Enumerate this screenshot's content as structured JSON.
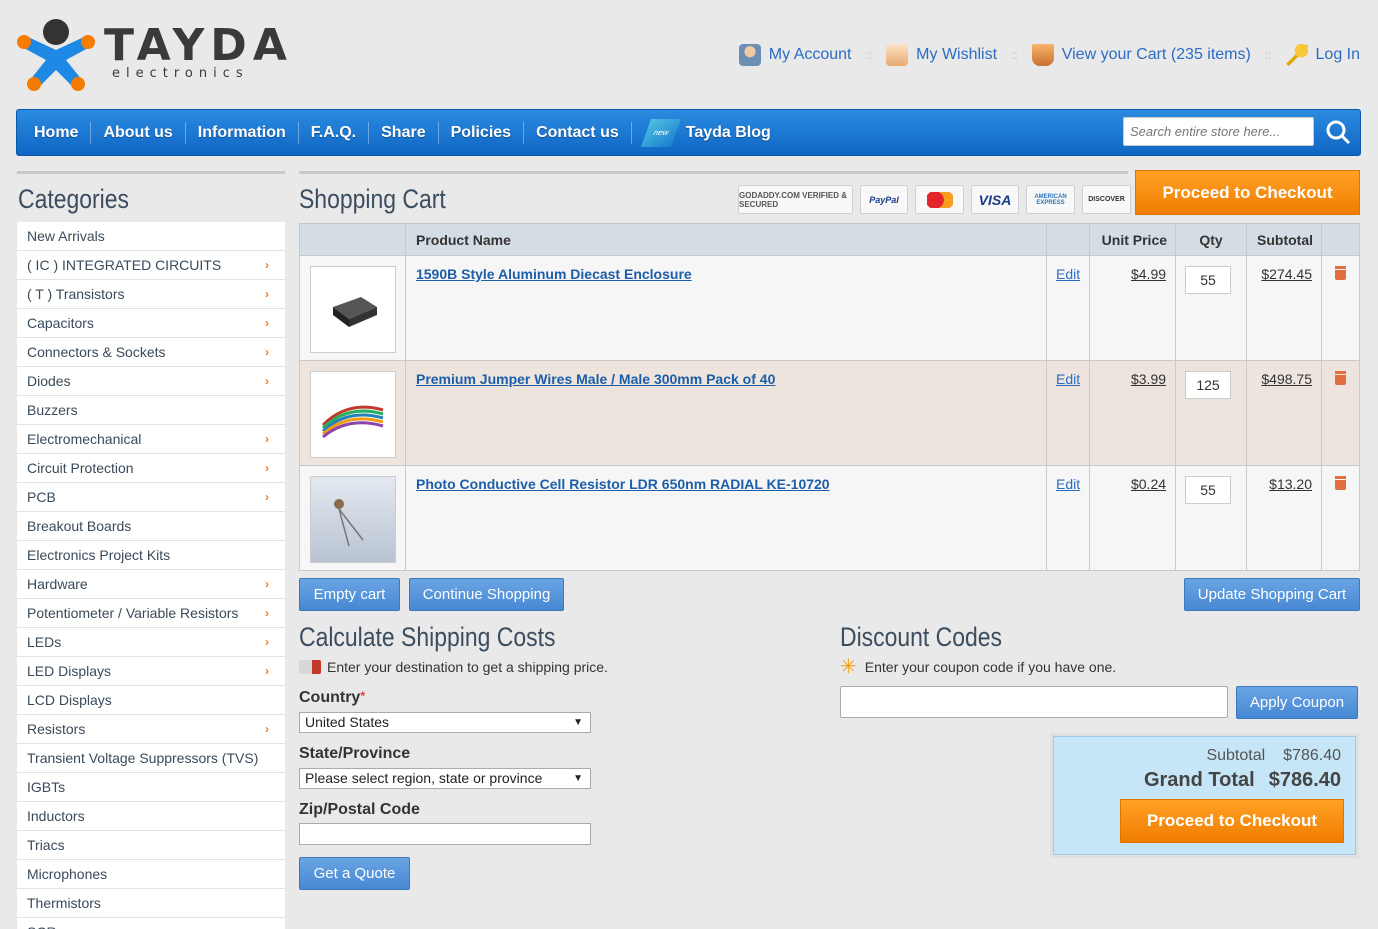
{
  "brand": {
    "name": "TAYDA",
    "sub": "electronics"
  },
  "toplinks": [
    {
      "label": "My Account",
      "icon": "user-icon"
    },
    {
      "label": "My Wishlist",
      "icon": "wishlist-icon"
    },
    {
      "label": "View your Cart (235 items)",
      "icon": "basket-icon"
    },
    {
      "label": "Log In",
      "icon": "key-icon"
    }
  ],
  "nav": [
    "Home",
    "About us",
    "Information",
    "F.A.Q.",
    "Share",
    "Policies",
    "Contact us"
  ],
  "nav_blog": {
    "tag": "new",
    "label": "Tayda Blog"
  },
  "search": {
    "placeholder": "Search entire store here..."
  },
  "sidebar": {
    "title": "Categories",
    "items": [
      {
        "label": "New Arrivals",
        "arrow": false
      },
      {
        "label": "( IC ) INTEGRATED CIRCUITS",
        "arrow": true
      },
      {
        "label": "( T ) Transistors",
        "arrow": true
      },
      {
        "label": "Capacitors",
        "arrow": true
      },
      {
        "label": "Connectors & Sockets",
        "arrow": true
      },
      {
        "label": "Diodes",
        "arrow": true
      },
      {
        "label": "Buzzers",
        "arrow": false
      },
      {
        "label": "Electromechanical",
        "arrow": true
      },
      {
        "label": "Circuit Protection",
        "arrow": true
      },
      {
        "label": "PCB",
        "arrow": true
      },
      {
        "label": "Breakout Boards",
        "arrow": false
      },
      {
        "label": "Electronics Project Kits",
        "arrow": false
      },
      {
        "label": "Hardware",
        "arrow": true
      },
      {
        "label": "Potentiometer / Variable Resistors",
        "arrow": true
      },
      {
        "label": "LEDs",
        "arrow": true
      },
      {
        "label": "LED Displays",
        "arrow": true
      },
      {
        "label": "LCD Displays",
        "arrow": false
      },
      {
        "label": "Resistors",
        "arrow": true
      },
      {
        "label": "Transient Voltage Suppressors (TVS)",
        "arrow": false
      },
      {
        "label": "IGBTs",
        "arrow": false
      },
      {
        "label": "Inductors",
        "arrow": false
      },
      {
        "label": "Triacs",
        "arrow": false
      },
      {
        "label": "Microphones",
        "arrow": false
      },
      {
        "label": "Thermistors",
        "arrow": false
      },
      {
        "label": "SCRs",
        "arrow": false
      }
    ]
  },
  "cart": {
    "title": "Shopping Cart",
    "badges": [
      "GODADDY.COM VERIFIED & SECURED",
      "PayPal",
      "MasterCard",
      "VISA",
      "AMERICAN EXPRESS",
      "DISCOVER"
    ],
    "checkout_top": "Proceed to Checkout",
    "headers": {
      "name": "Product Name",
      "price": "Unit Price",
      "qty": "Qty",
      "subtotal": "Subtotal"
    },
    "rows": [
      {
        "name": "1590B Style Aluminum Diecast Enclosure",
        "edit": "Edit",
        "price": "$4.99",
        "qty": "55",
        "subtotal": "$274.45"
      },
      {
        "name": "Premium Jumper Wires Male / Male 300mm Pack of 40",
        "edit": "Edit",
        "price": "$3.99",
        "qty": "125",
        "subtotal": "$498.75"
      },
      {
        "name": "Photo Conductive Cell Resistor LDR 650nm RADIAL KE-10720",
        "edit": "Edit",
        "price": "$0.24",
        "qty": "55",
        "subtotal": "$13.20"
      }
    ],
    "empty_btn": "Empty cart",
    "continue_btn": "Continue Shopping",
    "update_btn": "Update Shopping Cart"
  },
  "shipping": {
    "title": "Calculate Shipping Costs",
    "hint": "Enter your destination to get a shipping price.",
    "country_label": "Country",
    "country_value": "United States",
    "state_label": "State/Province",
    "state_value": "Please select region, state or province",
    "zip_label": "Zip/Postal Code",
    "quote_btn": "Get a Quote"
  },
  "discount": {
    "title": "Discount Codes",
    "hint": "Enter your coupon code if you have one.",
    "apply_btn": "Apply Coupon"
  },
  "totals": {
    "subtotal_label": "Subtotal",
    "subtotal": "$786.40",
    "grand_label": "Grand Total",
    "grand": "$786.40",
    "checkout": "Proceed to Checkout"
  }
}
